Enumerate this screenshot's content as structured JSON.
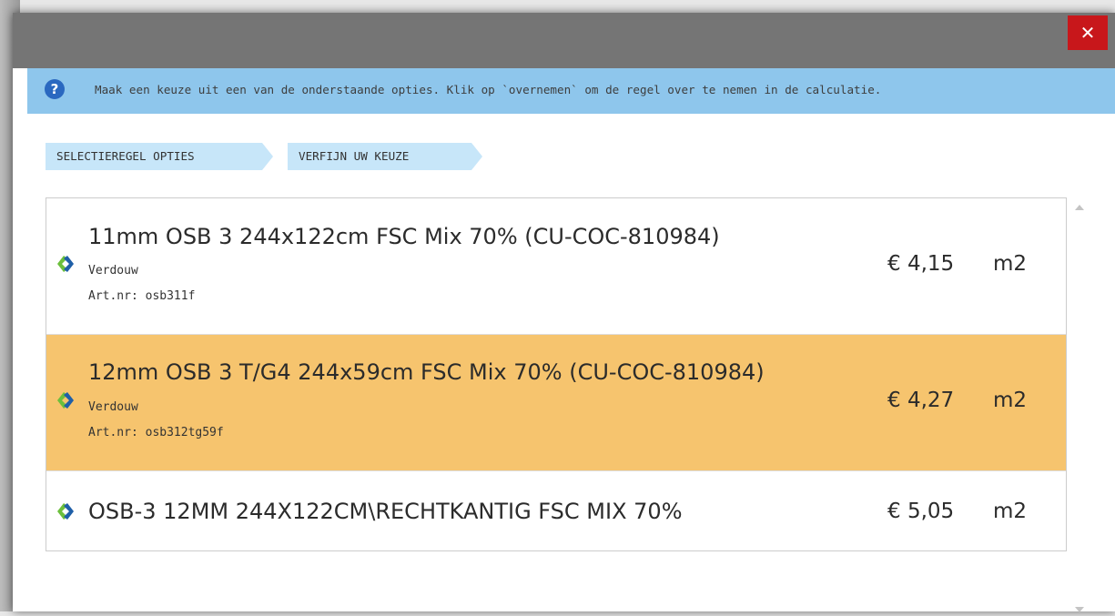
{
  "dialog": {
    "close_label": "✕"
  },
  "info": {
    "icon": "?",
    "text": "Maak een keuze uit een van de onderstaande opties. Klik op `overnemen` om de regel over te nemen in de calculatie."
  },
  "breadcrumbs": [
    {
      "label": "SELECTIEREGEL OPTIES"
    },
    {
      "label": "VERFIJN UW KEUZE"
    }
  ],
  "options": [
    {
      "title": "11mm OSB 3 244x122cm FSC Mix 70% (CU-COC-810984)",
      "supplier": "Verdouw",
      "article": "Art.nr: osb311f",
      "price": "€ 4,15",
      "unit": "m2",
      "selected": false
    },
    {
      "title": "12mm OSB 3 T/G4 244x59cm FSC Mix 70% (CU-COC-810984)",
      "supplier": "Verdouw",
      "article": "Art.nr: osb312tg59f",
      "price": "€ 4,27",
      "unit": "m2",
      "selected": true
    },
    {
      "title": "OSB-3 12MM 244X122CM\\RECHTKANTIG FSC MIX 70%",
      "price": "€ 5,05",
      "unit": "m2",
      "selected": false
    }
  ],
  "colors": {
    "titlebar": "#757575",
    "close_button": "#c8171b",
    "info_bar": "#8ec6ec",
    "breadcrumb": "#c7e6f9",
    "selected_row": "#f6c46e",
    "logo_green": "#6cbf3c",
    "logo_blue": "#1f5fa8"
  },
  "icons": {
    "info": "question-circle-icon",
    "close": "close-icon",
    "supplier_logo": "supplier-logo-icon",
    "scroll_up": "scroll-up-arrow-icon",
    "scroll_down": "scroll-down-arrow-icon"
  }
}
